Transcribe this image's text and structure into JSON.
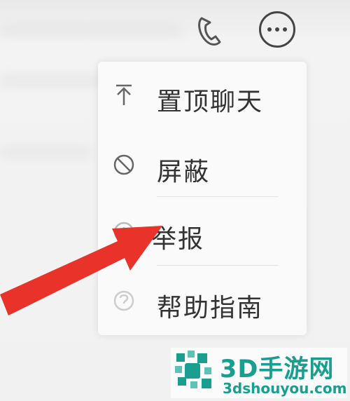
{
  "menu": {
    "items": [
      {
        "label": "置顶聊天",
        "icon": "pin-top-icon"
      },
      {
        "label": "屏蔽",
        "icon": "block-icon"
      },
      {
        "label": "举报",
        "icon": "report-icon"
      },
      {
        "label": "帮助指南",
        "icon": "help-icon"
      }
    ]
  },
  "topbar": {
    "icons": [
      "phone-icon",
      "more-options-icon"
    ]
  },
  "watermark": {
    "site_name": "3D手游网",
    "url": "3dshouyou.com"
  },
  "colors": {
    "arrow": "#e8322a",
    "watermark": "#1a9e90"
  }
}
